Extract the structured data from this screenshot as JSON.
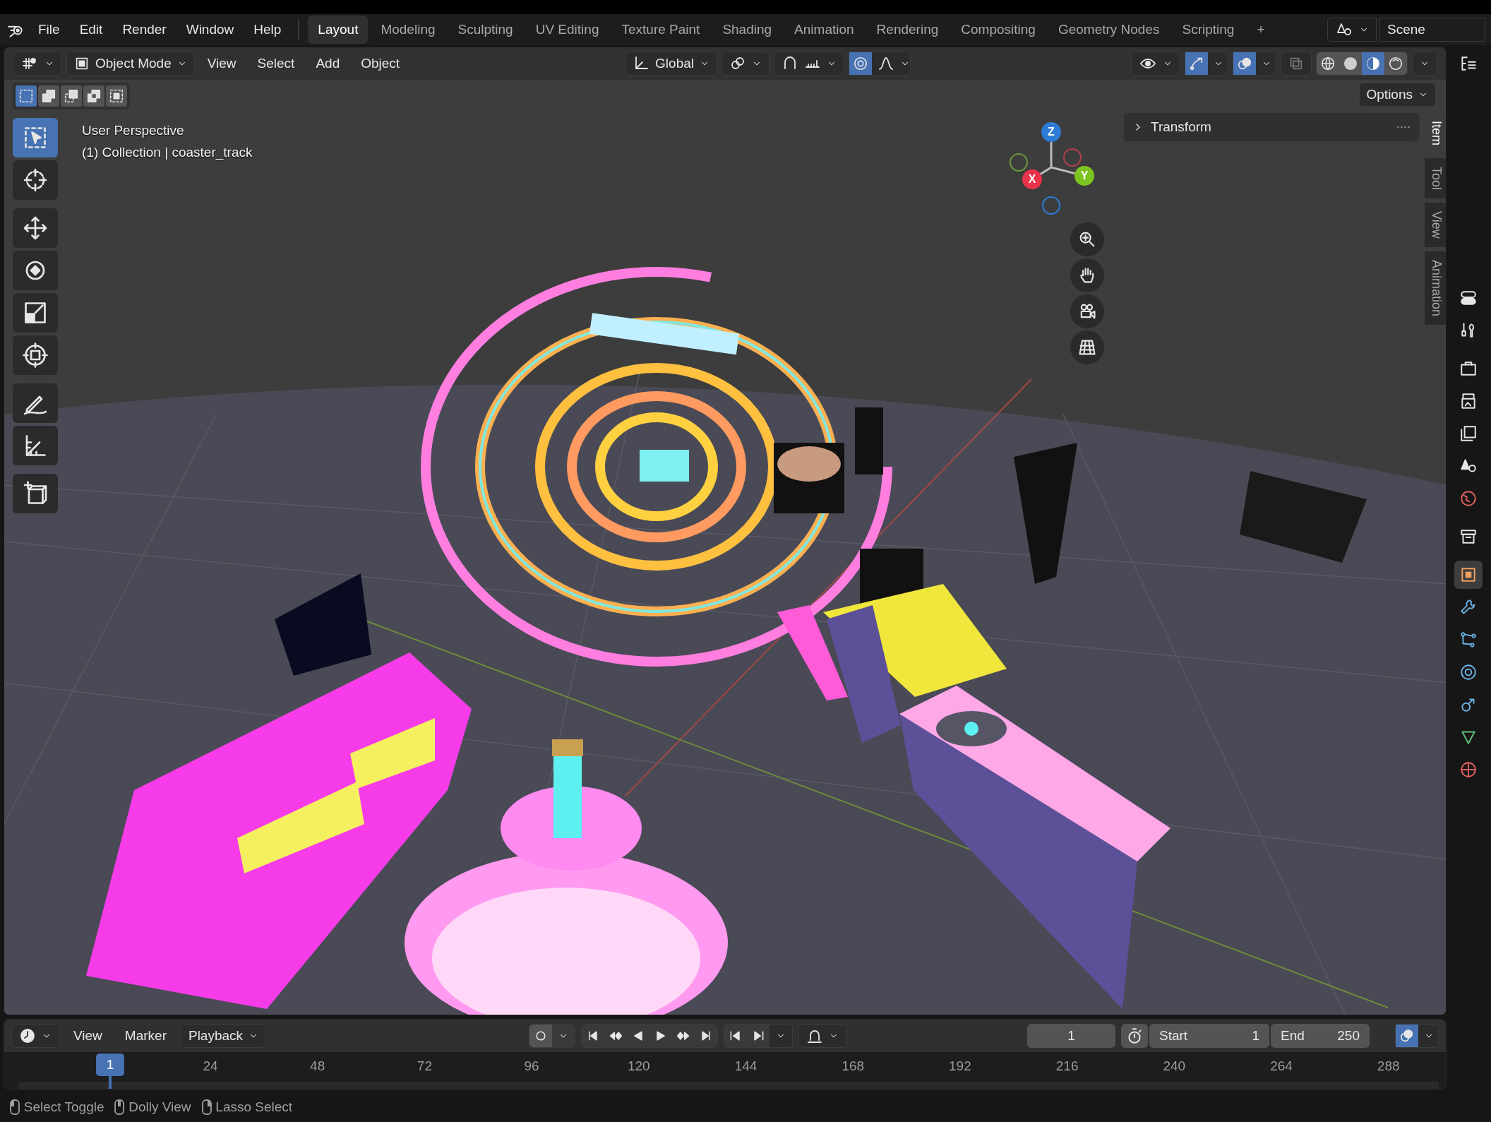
{
  "top_bar": {
    "menus": [
      "File",
      "Edit",
      "Render",
      "Window",
      "Help"
    ],
    "workspaces": [
      {
        "label": "Layout",
        "selected": true
      },
      {
        "label": "Modeling",
        "selected": false
      },
      {
        "label": "Sculpting",
        "selected": false
      },
      {
        "label": "UV Editing",
        "selected": false
      },
      {
        "label": "Texture Paint",
        "selected": false
      },
      {
        "label": "Shading",
        "selected": false
      },
      {
        "label": "Animation",
        "selected": false
      },
      {
        "label": "Rendering",
        "selected": false
      },
      {
        "label": "Compositing",
        "selected": false
      },
      {
        "label": "Geometry Nodes",
        "selected": false
      },
      {
        "label": "Scripting",
        "selected": false
      }
    ],
    "add_tab": "+",
    "scene": "Scene"
  },
  "viewport_header": {
    "mode": "Object Mode",
    "menus": [
      "View",
      "Select",
      "Add",
      "Object"
    ],
    "orientation": "Global",
    "shading_modes": [
      {
        "kind": "wireframe",
        "selected": false
      },
      {
        "kind": "solid",
        "selected": false
      },
      {
        "kind": "material",
        "selected": true
      },
      {
        "kind": "rendered",
        "selected": false
      }
    ]
  },
  "select_modes": [
    {
      "selected": true
    },
    {
      "selected": false
    },
    {
      "selected": false
    },
    {
      "selected": false
    },
    {
      "selected": false
    }
  ],
  "options": "Options",
  "overlay_text": {
    "view": "User Perspective",
    "object": "(1) Collection | coaster_track"
  },
  "toolbar": [
    {
      "kind": "select",
      "selected": true
    },
    {
      "kind": "cursor",
      "selected": false
    },
    {
      "kind": "move",
      "selected": false
    },
    {
      "kind": "rotate",
      "selected": false
    },
    {
      "kind": "scale",
      "selected": false
    },
    {
      "kind": "transform",
      "selected": false
    },
    {
      "kind": "annotate",
      "selected": false
    },
    {
      "kind": "measure",
      "selected": false
    },
    {
      "kind": "add-cube",
      "selected": false
    }
  ],
  "gizmo": {
    "axes": [
      {
        "label": "Z",
        "color": "#2e7bd6"
      },
      {
        "label": "X",
        "color": "#e8334a"
      },
      {
        "label": "Y",
        "color": "#7cc420"
      }
    ]
  },
  "sidebar": {
    "panel": {
      "title": "Transform",
      "expanded": false
    },
    "tabs": [
      {
        "label": "Item",
        "selected": true
      },
      {
        "label": "Tool",
        "selected": false
      },
      {
        "label": "View",
        "selected": false
      },
      {
        "label": "Animation",
        "selected": false
      }
    ]
  },
  "properties_tabs": [
    {
      "kind": "tool",
      "selected": false
    },
    {
      "kind": "render",
      "selected": false
    },
    {
      "kind": "output",
      "selected": false
    },
    {
      "kind": "view-layer",
      "selected": false
    },
    {
      "kind": "scene",
      "selected": false
    },
    {
      "kind": "world",
      "selected": false
    },
    {
      "kind": "collection",
      "selected": false
    },
    {
      "kind": "object",
      "selected": true
    },
    {
      "kind": "modifiers",
      "selected": false
    },
    {
      "kind": "particles",
      "selected": false
    },
    {
      "kind": "physics",
      "selected": false
    },
    {
      "kind": "constraints",
      "selected": false
    },
    {
      "kind": "data",
      "selected": false
    },
    {
      "kind": "material",
      "selected": false
    }
  ],
  "timeline": {
    "menus": [
      "View",
      "Marker"
    ],
    "playback": "Playback",
    "current_frame": "1",
    "start_label": "Start",
    "start": "1",
    "end_label": "End",
    "end": "250",
    "playhead": "1",
    "ruler": [
      "24",
      "48",
      "72",
      "96",
      "120",
      "144",
      "168",
      "192",
      "216",
      "240",
      "264",
      "288"
    ]
  },
  "status_bar": [
    "Select Toggle",
    "Dolly View",
    "Lasso Select"
  ]
}
